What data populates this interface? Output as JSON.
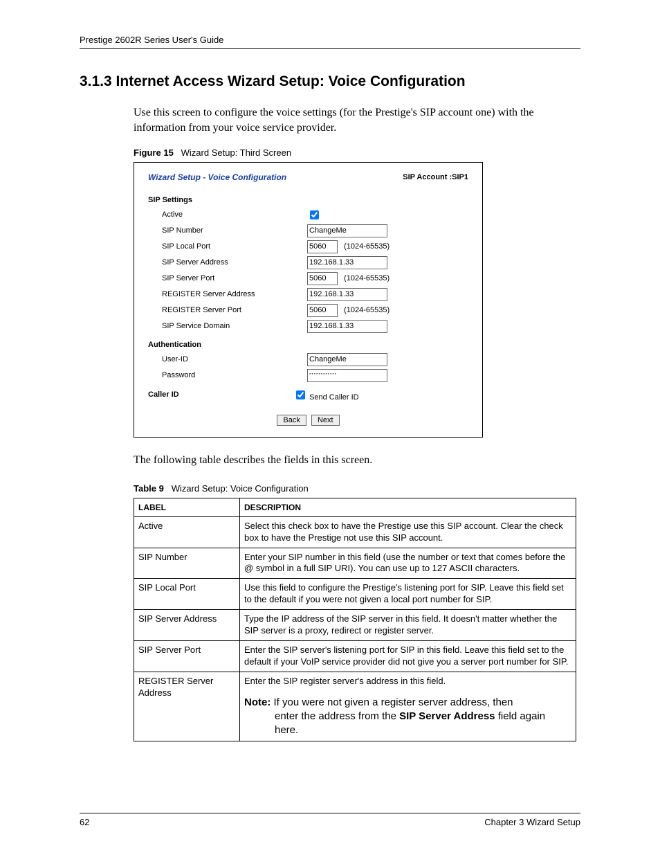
{
  "header": {
    "running_head": "Prestige 2602R Series User's Guide"
  },
  "section": {
    "title": "3.1.3  Internet Access Wizard Setup: Voice Configuration",
    "intro": "Use this screen to configure the voice settings (for the Prestige's SIP account one) with the information from your voice service provider."
  },
  "figure": {
    "caption_label": "Figure 15",
    "caption_text": "Wizard Setup: Third Screen",
    "panel_title": "Wizard Setup - Voice Configuration",
    "account_label": "SIP Account :SIP1",
    "groups": {
      "sip_settings": "SIP Settings",
      "authentication": "Authentication",
      "caller_id": "Caller ID"
    },
    "fields": {
      "active": {
        "label": "Active",
        "checked": true
      },
      "sip_number": {
        "label": "SIP Number",
        "value": "ChangeMe"
      },
      "sip_local_port": {
        "label": "SIP Local Port",
        "value": "5060",
        "hint": "(1024-65535)"
      },
      "sip_server_address": {
        "label": "SIP Server Address",
        "value": "192.168.1.33"
      },
      "sip_server_port": {
        "label": "SIP Server Port",
        "value": "5060",
        "hint": "(1024-65535)"
      },
      "register_server_address": {
        "label": "REGISTER Server Address",
        "value": "192.168.1.33"
      },
      "register_server_port": {
        "label": "REGISTER Server Port",
        "value": "5060",
        "hint": "(1024-65535)"
      },
      "sip_service_domain": {
        "label": "SIP Service Domain",
        "value": "192.168.1.33"
      },
      "user_id": {
        "label": "User-ID",
        "value": "ChangeMe"
      },
      "password": {
        "label": "Password",
        "value": "************"
      },
      "send_caller_id": {
        "label": "Send Caller ID",
        "checked": true
      }
    },
    "buttons": {
      "back": "Back",
      "next": "Next"
    }
  },
  "between_text": "The following table describes the fields in this screen.",
  "table": {
    "caption_label": "Table 9",
    "caption_text": "Wizard Setup: Voice Configuration",
    "head": {
      "label": "LABEL",
      "desc": "DESCRIPTION"
    },
    "rows": [
      {
        "label": "Active",
        "desc": "Select this check box to have the Prestige use this SIP account. Clear the check box to have the Prestige not use this SIP account."
      },
      {
        "label": "SIP Number",
        "desc": "Enter your SIP number in this field (use the number or text that comes before the @ symbol in a full SIP URI).  You can use up to 127 ASCII characters."
      },
      {
        "label": "SIP Local Port",
        "desc": "Use this field to configure the Prestige's listening port for SIP. Leave this field set to the default if you were not given a local port number for SIP."
      },
      {
        "label": "SIP Server Address",
        "desc": "Type the IP address of the SIP server in this field. It doesn't matter whether the SIP server is a proxy, redirect or register server."
      },
      {
        "label": "SIP Server Port",
        "desc": "Enter the SIP server's listening port for SIP in this field. Leave this field set to the default if your VoIP service provider did not give you a server port number for SIP."
      },
      {
        "label": "REGISTER Server Address",
        "desc": "Enter the SIP register server's address in this field."
      }
    ],
    "note": {
      "prefix": "Note:",
      "text1": "If you were not given a register server address, then",
      "text2": "enter the address from the ",
      "bold": "SIP Server Address",
      "text3": " field again here."
    }
  },
  "footer": {
    "page": "62",
    "chapter": "Chapter 3 Wizard Setup"
  }
}
